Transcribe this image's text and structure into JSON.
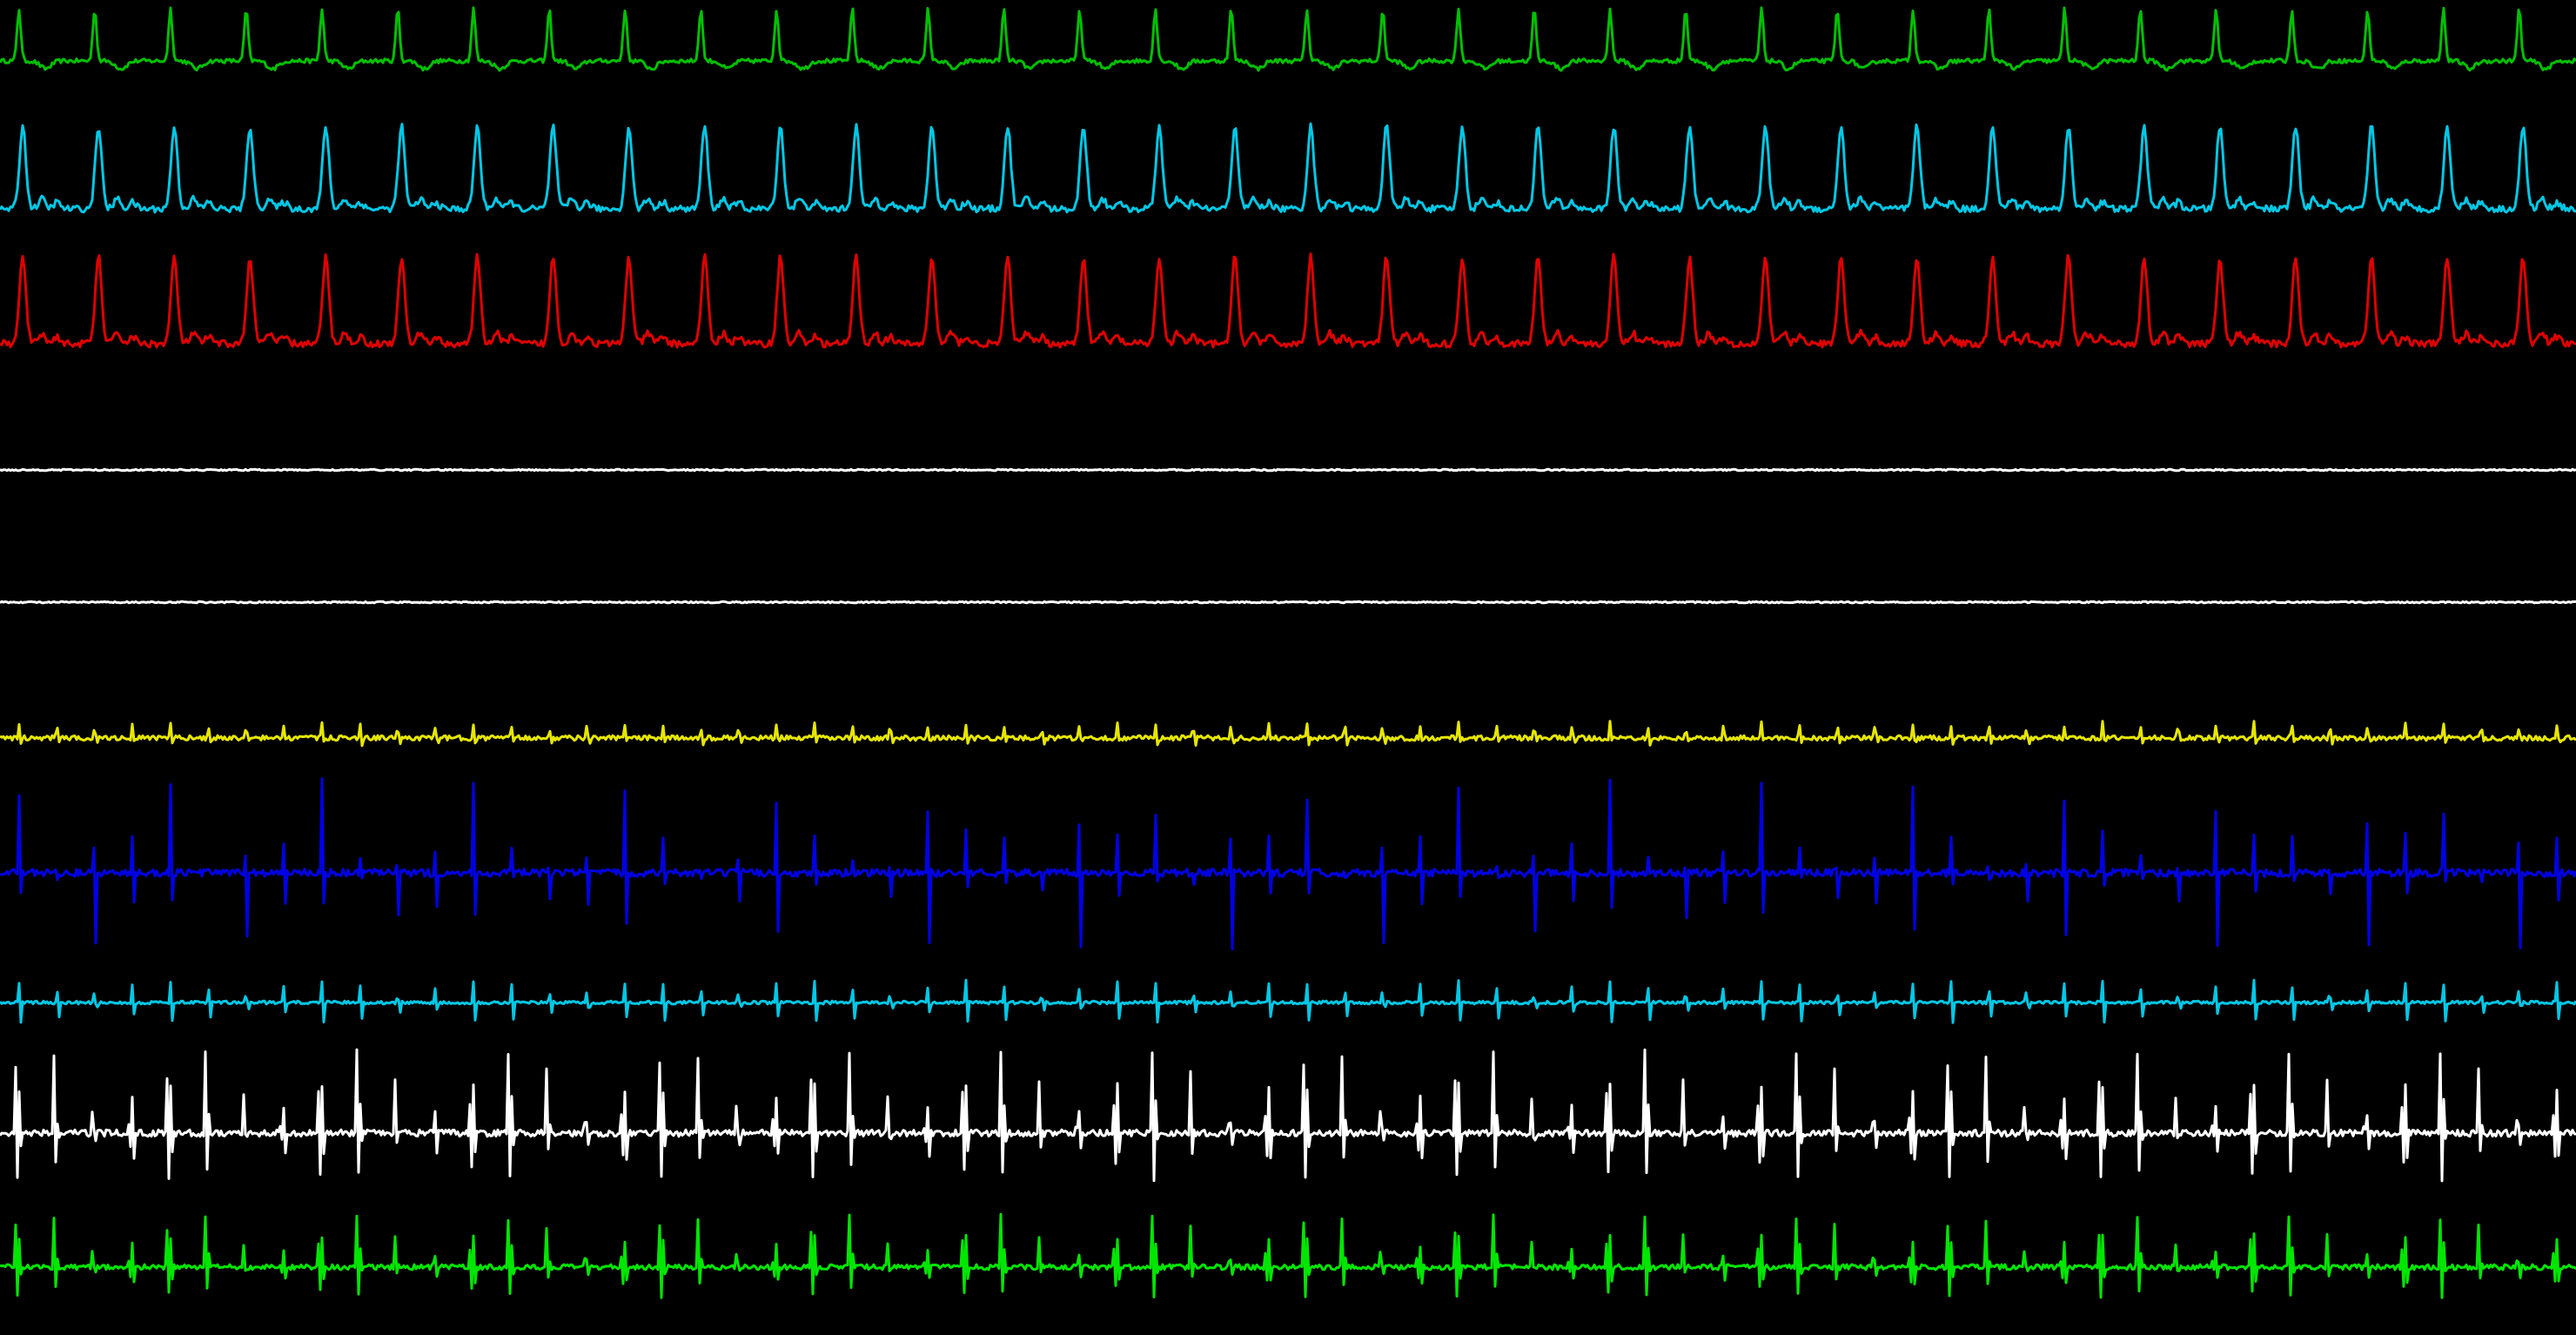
{
  "screen": {
    "background": "#000000"
  },
  "channels": [
    {
      "id": "ch1",
      "color": "#00c000",
      "morphology": "inverted-beat",
      "beats": 34,
      "amplitude": 1.0
    },
    {
      "id": "ch2",
      "color": "#00c8e6",
      "morphology": "pressure-pulse",
      "beats": 34,
      "amplitude": 1.0
    },
    {
      "id": "ch3",
      "color": "#e00000",
      "morphology": "pressure-pulse",
      "beats": 34,
      "amplitude": 1.0
    },
    {
      "id": "ch4",
      "color": "#ffffff",
      "morphology": "flat-noise",
      "beats": 0,
      "amplitude": 0.1
    },
    {
      "id": "ch5",
      "color": "#ffffff",
      "morphology": "flat-noise",
      "beats": 0,
      "amplitude": 0.1
    },
    {
      "id": "ch6",
      "color": "#e6e600",
      "morphology": "small-spike-train",
      "beats": 68,
      "amplitude": 0.3
    },
    {
      "id": "ch7",
      "color": "#0000e6",
      "morphology": "tall-spike-train",
      "beats": 68,
      "amplitude": 1.0
    },
    {
      "id": "ch8",
      "color": "#00c8e6",
      "morphology": "biphasic-spike-train",
      "beats": 68,
      "amplitude": 0.6
    },
    {
      "id": "ch9",
      "color": "#ffffff",
      "morphology": "fractionated-train",
      "beats": 68,
      "amplitude": 1.0
    },
    {
      "id": "ch10",
      "color": "#00e600",
      "morphology": "fractionated-train",
      "beats": 68,
      "amplitude": 0.8
    }
  ]
}
